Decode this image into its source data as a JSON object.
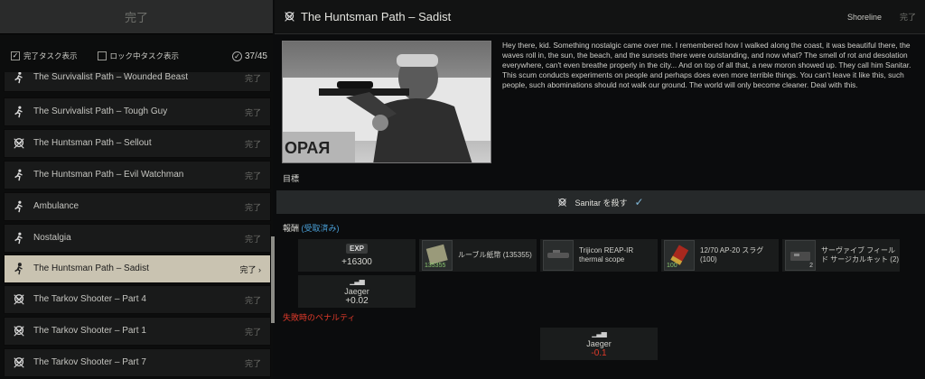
{
  "left": {
    "header": "完了",
    "filter_completed": "完了タスク表示",
    "filter_locked": "ロック中タスク表示",
    "count": "37/45"
  },
  "tasks": [
    {
      "name": "The Survivalist Path – Wounded Beast",
      "status": "完了",
      "icon": "running-man-icon"
    },
    {
      "name": "The Survivalist Path – Tough Guy",
      "status": "完了",
      "icon": "running-man-icon"
    },
    {
      "name": "The Huntsman Path – Sellout",
      "status": "完了",
      "icon": "skull-icon"
    },
    {
      "name": "The Huntsman Path – Evil Watchman",
      "status": "完了",
      "icon": "running-man-icon"
    },
    {
      "name": "Ambulance",
      "status": "完了",
      "icon": "running-man-icon"
    },
    {
      "name": "Nostalgia",
      "status": "完了",
      "icon": "running-man-icon"
    },
    {
      "name": "The Huntsman Path – Sadist",
      "status": "完了 ›",
      "icon": "running-man-icon",
      "selected": true
    },
    {
      "name": "The Tarkov Shooter – Part 4",
      "status": "完了",
      "icon": "skull-icon"
    },
    {
      "name": "The Tarkov Shooter – Part 1",
      "status": "完了",
      "icon": "skull-icon"
    },
    {
      "name": "The Tarkov Shooter – Part 7",
      "status": "完了",
      "icon": "skull-icon"
    }
  ],
  "quest": {
    "title": "The Huntsman Path – Sadist",
    "location": "Shoreline",
    "status": "完了",
    "photo_sign": "ОРАЯ",
    "description": "Hey there, kid. Something nostalgic came over me. I remembered how I walked along the coast, it was beautiful there, the waves roll in, the sun, the beach, and the sunsets there were outstanding, and now what? The smell of rot and desolation everywhere, can't even breathe properly in the city... And on top of all that, a new moron showed up. They call him Sanitar. This scum conducts experiments on people and perhaps does even more terrible things. You can't leave it like this, such people, such abominations should not walk our ground. The world will only become cleaner. Deal with this.",
    "objectives_label": "目標",
    "objective": "Sanitar を殺す",
    "rewards_label": "報酬",
    "rewards_received": "(受取済み)",
    "exp_badge": "EXP",
    "exp_value": "+16300",
    "rewards": [
      {
        "name": "ルーブル紙幣 (135355)",
        "qty": "135355"
      },
      {
        "name": "Trijicon REAP-IR thermal scope",
        "qty": ""
      },
      {
        "name": "12/70 AP-20 スラグ (100)",
        "qty": "100"
      },
      {
        "name": "サーヴァイブ フィールド サージカルキット (2)",
        "qty": "2"
      }
    ],
    "rep_trader": "Jaeger",
    "rep_value": "+0.02",
    "failure_label": "失敗時のペナルティ",
    "fail_trader": "Jaeger",
    "fail_value": "-0.1"
  },
  "colors": {
    "selected_bg": "#c9c3b1",
    "accent_blue": "#4aa0d8",
    "penalty_red": "#e03a2a"
  }
}
